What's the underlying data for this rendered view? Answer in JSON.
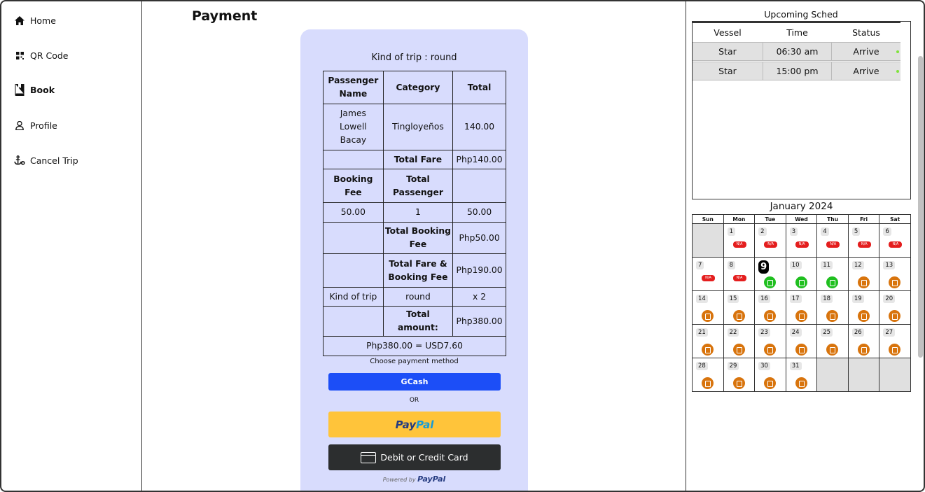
{
  "sidebar": {
    "items": [
      {
        "label": "Home",
        "icon": "home-icon"
      },
      {
        "label": "QR Code",
        "icon": "qr-code-icon"
      },
      {
        "label": "Book",
        "icon": "book-icon"
      },
      {
        "label": "Profile",
        "icon": "user-icon"
      },
      {
        "label": "Cancel Trip",
        "icon": "anchor-icon"
      }
    ]
  },
  "main": {
    "title": "Payment",
    "kind_of_trip": "Kind of trip : round",
    "table": {
      "h_name": "Passenger Name",
      "h_category": "Category",
      "h_total": "Total",
      "passenger_name": "James Lowell Bacay",
      "passenger_category": "Tingloyeños",
      "passenger_total": "140.00",
      "total_fare_label": "Total Fare",
      "total_fare_value": "Php140.00",
      "booking_fee_label": "Booking Fee",
      "total_passenger_label": "Total Passenger",
      "booking_fee_value": "50.00",
      "passenger_count": "1",
      "booking_fee_total": "50.00",
      "total_booking_fee_label": "Total Booking Fee",
      "total_booking_fee_value": "Php50.00",
      "fare_and_fee_label": "Total Fare & Booking Fee",
      "fare_and_fee_value": "Php190.00",
      "kind_label": "Kind of trip",
      "kind_value": "round",
      "multiplier": "x 2",
      "total_amount_label": "Total amount:",
      "total_amount_value": "Php380.00",
      "conversion": "Php380.00 = USD7.60"
    },
    "choose_label": "Choose payment method",
    "gcash_label": "GCash",
    "or_label": "OR",
    "paypal_left": "Pay",
    "paypal_right": "Pal",
    "card_label": "Debit or Credit Card",
    "powered_by": "Powered by",
    "powered_brand": "PayPal"
  },
  "schedule": {
    "title": "Upcoming Sched",
    "headers": [
      "Vessel",
      "Time",
      "Status"
    ],
    "rows": [
      {
        "vessel": "Star",
        "time": "06:30 am",
        "status": "Arrive"
      },
      {
        "vessel": "Star",
        "time": "15:00 pm",
        "status": "Arrive"
      }
    ],
    "status_color": "#7fe33b"
  },
  "calendar": {
    "title": "January 2024",
    "weekdays": [
      "Sun",
      "Mon",
      "Tue",
      "Wed",
      "Thu",
      "Fri",
      "Sat"
    ],
    "na_label": "N/A",
    "today": 9,
    "colors": {
      "na": "#e41e1e",
      "available": "#1fbf1f",
      "booked": "#d8740d"
    },
    "days": [
      {
        "day": "1",
        "status": "na"
      },
      {
        "day": "2",
        "status": "na"
      },
      {
        "day": "3",
        "status": "na"
      },
      {
        "day": "4",
        "status": "na"
      },
      {
        "day": "5",
        "status": "na"
      },
      {
        "day": "6",
        "status": "na"
      },
      {
        "day": "7",
        "status": "na"
      },
      {
        "day": "8",
        "status": "na"
      },
      {
        "day": "9",
        "status": "available"
      },
      {
        "day": "10",
        "status": "available"
      },
      {
        "day": "11",
        "status": "available"
      },
      {
        "day": "12",
        "status": "booked"
      },
      {
        "day": "13",
        "status": "booked"
      },
      {
        "day": "14",
        "status": "booked"
      },
      {
        "day": "15",
        "status": "booked"
      },
      {
        "day": "16",
        "status": "booked"
      },
      {
        "day": "17",
        "status": "booked"
      },
      {
        "day": "18",
        "status": "booked"
      },
      {
        "day": "19",
        "status": "booked"
      },
      {
        "day": "20",
        "status": "booked"
      },
      {
        "day": "21",
        "status": "booked"
      },
      {
        "day": "22",
        "status": "booked"
      },
      {
        "day": "23",
        "status": "booked"
      },
      {
        "day": "24",
        "status": "booked"
      },
      {
        "day": "25",
        "status": "booked"
      },
      {
        "day": "26",
        "status": "booked"
      },
      {
        "day": "27",
        "status": "booked"
      },
      {
        "day": "28",
        "status": "booked"
      },
      {
        "day": "29",
        "status": "booked"
      },
      {
        "day": "30",
        "status": "booked"
      },
      {
        "day": "31",
        "status": "booked"
      }
    ]
  }
}
